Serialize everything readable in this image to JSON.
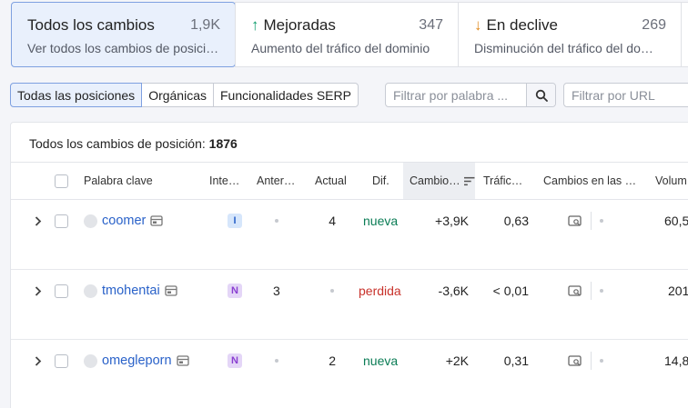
{
  "summary_cards": [
    {
      "title": "Todos los cambios",
      "count": "1,9K",
      "description": "Ver todos los cambios de posici…",
      "arrow": ""
    },
    {
      "title": "Mejoradas",
      "count": "347",
      "description": "Aumento del tráfico del dominio",
      "arrow": "↑"
    },
    {
      "title": "En declive",
      "count": "269",
      "description": "Disminución del tráfico del do…",
      "arrow": "↓"
    }
  ],
  "filters": {
    "segments": [
      "Todas las posiciones",
      "Orgánicas",
      "Funcionalidades SERP"
    ],
    "keyword_placeholder": "Filtrar por palabra ...",
    "url_placeholder": "Filtrar por URL"
  },
  "table": {
    "title_label": "Todos los cambios de posición:",
    "title_count": "1876",
    "columns": [
      "Palabra clave",
      "Inte…",
      "Anter…",
      "Actual",
      "Dif.",
      "Cambio…",
      "Tráfic…",
      "Cambios en las …",
      "Volum"
    ],
    "rows": [
      {
        "keyword": "coomer",
        "intent": "I",
        "previous": "",
        "current": "4",
        "diff": "nueva",
        "change": "+3,9K",
        "traffic": "0,63",
        "volume": "60,5"
      },
      {
        "keyword": "tmohentai",
        "intent": "N",
        "previous": "3",
        "current": "",
        "diff": "perdida",
        "change": "-3,6K",
        "traffic": "< 0,01",
        "volume": "201"
      },
      {
        "keyword": "omegleporn",
        "intent": "N",
        "previous": "",
        "current": "2",
        "diff": "nueva",
        "change": "+2K",
        "traffic": "0,31",
        "volume": "14,8"
      }
    ]
  },
  "colors": {
    "accent_blue": "#2a62c9",
    "positive": "#0a7c55",
    "negative": "#c8322b",
    "up_arrow": "#0a9b6a",
    "down_arrow": "#e08a1e"
  }
}
